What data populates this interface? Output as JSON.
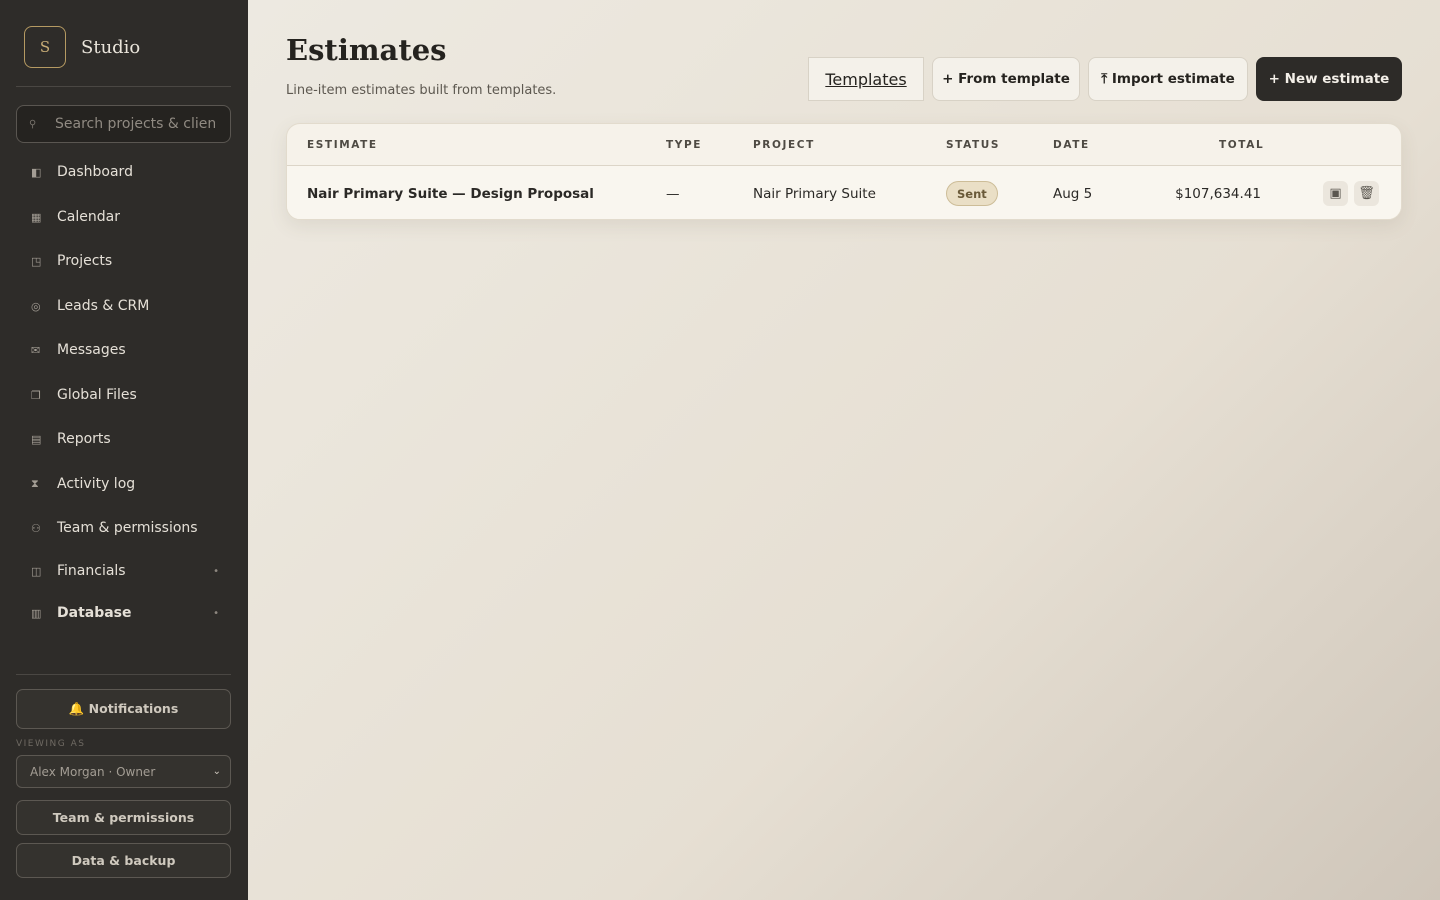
{
  "brand": {
    "mark": "S",
    "name": "Studio"
  },
  "search": {
    "placeholder": "Search projects & clients"
  },
  "nav": [
    {
      "label": "Dashboard",
      "icon": "dashboard-icon"
    },
    {
      "label": "Calendar",
      "icon": "calendar-icon"
    },
    {
      "label": "Projects",
      "icon": "projects-icon"
    },
    {
      "label": "Leads & CRM",
      "icon": "leads-icon"
    },
    {
      "label": "Messages",
      "icon": "messages-icon"
    },
    {
      "label": "Global Files",
      "icon": "files-icon"
    },
    {
      "label": "Reports",
      "icon": "reports-icon"
    },
    {
      "label": "Activity log",
      "icon": "activity-icon"
    },
    {
      "label": "Team & permissions",
      "icon": "team-icon"
    },
    {
      "label": "Financials",
      "icon": "financials-icon"
    },
    {
      "label": "Database",
      "icon": "database-icon"
    }
  ],
  "sidebar_footer": {
    "notifications": "🔔 Notifications",
    "viewing_as_label": "VIEWING AS",
    "viewing_as_value": "Alex Morgan · Owner",
    "team_button": "Team & permissions",
    "backup_button": "Data & backup"
  },
  "header": {
    "title": "Estimates",
    "subtitle": "Line-item estimates built from templates.",
    "templates_label": "Templates",
    "from_template_label": "+ From template",
    "import_label": "⤒ Import estimate",
    "new_label": "+ New estimate"
  },
  "table": {
    "columns": [
      "ESTIMATE",
      "TYPE",
      "PROJECT",
      "STATUS",
      "DATE",
      "TOTAL"
    ],
    "rows": [
      {
        "estimate": "Nair Primary Suite — Design Proposal",
        "type": "—",
        "project": "Nair Primary Suite",
        "status": "Sent",
        "date": "Aug 5",
        "total": "$107,634.41"
      }
    ]
  },
  "colors": {
    "sidebar_bg": "#2e2c29",
    "accent_gold": "#c8ad76",
    "dark_button": "#2d2b28"
  }
}
